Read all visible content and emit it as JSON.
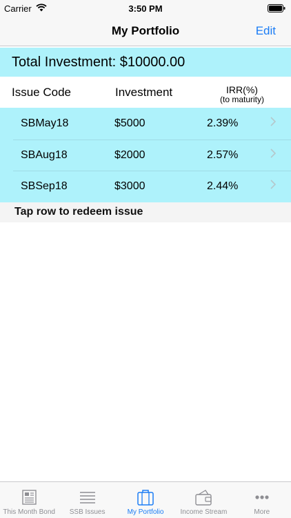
{
  "status_bar": {
    "carrier": "Carrier",
    "time": "3:50 PM"
  },
  "nav": {
    "title": "My Portfolio",
    "edit_label": "Edit"
  },
  "total": {
    "text": "Total Investment: $10000.00"
  },
  "table": {
    "headers": {
      "code": "Issue Code",
      "investment": "Investment",
      "irr": "IRR(%)",
      "irr_sub": "(to maturity)"
    },
    "rows": [
      {
        "code": "SBMay18",
        "investment": "$5000",
        "irr": "2.39%"
      },
      {
        "code": "SBAug18",
        "investment": "$2000",
        "irr": "2.57%"
      },
      {
        "code": "SBSep18",
        "investment": "$3000",
        "irr": "2.44%"
      }
    ]
  },
  "hint": "Tap row to redeem issue",
  "tabs": [
    {
      "label": "This Month Bond",
      "icon": "newspaper-icon"
    },
    {
      "label": "SSB Issues",
      "icon": "list-icon"
    },
    {
      "label": "My Portfolio",
      "icon": "briefcase-icon",
      "active": true
    },
    {
      "label": "Income Stream",
      "icon": "wallet-icon"
    },
    {
      "label": "More",
      "icon": "more-icon"
    }
  ],
  "colors": {
    "accent": "#1a7cf5",
    "highlight": "#aef2fb",
    "inactive": "#8e8e93"
  }
}
